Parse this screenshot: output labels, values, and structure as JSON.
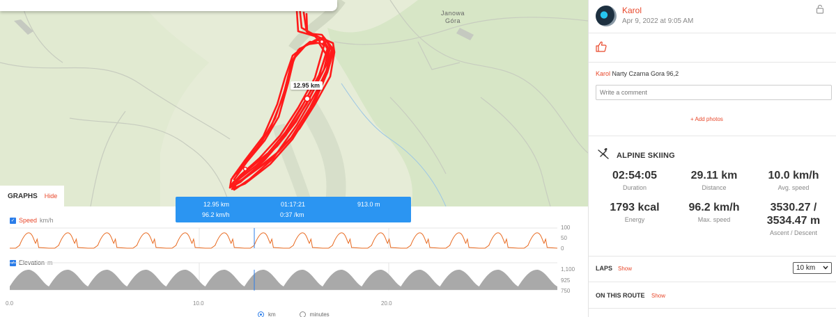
{
  "map": {
    "place_label_line1": "Janowa",
    "place_label_line2": "Góra",
    "distance_marker": "12.95 km"
  },
  "graphs": {
    "title": "GRAPHS",
    "hide_label": "Hide",
    "speed": {
      "name": "Speed",
      "unit": "km/h",
      "ticks": [
        "100",
        "50",
        "0"
      ]
    },
    "elevation": {
      "name": "Elevation",
      "unit": "m",
      "ticks": [
        "1,100",
        "925",
        "750"
      ]
    },
    "x_ticks": [
      "0.0",
      "10.0",
      "20.0"
    ],
    "x_unit_options": [
      "km",
      "minutes"
    ],
    "x_unit_selected": "km"
  },
  "infobox": {
    "distance": "12.95 km",
    "time": "01:17:21",
    "elevation": "913.0 m",
    "speed": "96.2 km/h",
    "pace": "0:37 /km"
  },
  "activity": {
    "athlete": "Karol",
    "date": "Apr 9, 2022 at 9:05 AM",
    "title": "Narty Czarna Gora 96,2",
    "comment_placeholder": "Write a comment",
    "add_photos": "+ Add photos",
    "sport": "ALPINE SKIING",
    "stats": [
      {
        "value": "02:54:05",
        "label": "Duration"
      },
      {
        "value": "29.11 km",
        "label": "Distance"
      },
      {
        "value": "10.0 km/h",
        "label": "Avg. speed"
      },
      {
        "value": "1793 kcal",
        "label": "Energy"
      },
      {
        "value": "96.2 km/h",
        "label": "Max. speed"
      },
      {
        "value_line1": "3530.27 /",
        "value_line2": "3534.47 m",
        "label": "Ascent / Descent"
      }
    ],
    "laps_title": "LAPS",
    "laps_show": "Show",
    "laps_value": "10 km",
    "route_title": "ON THIS ROUTE",
    "route_show": "Show"
  },
  "colors": {
    "accent": "#e8472a",
    "route": "#ff1a1a",
    "info": "#2b95f2",
    "elevation": "#a9a9a9",
    "cursor": "#2b7de9"
  }
}
